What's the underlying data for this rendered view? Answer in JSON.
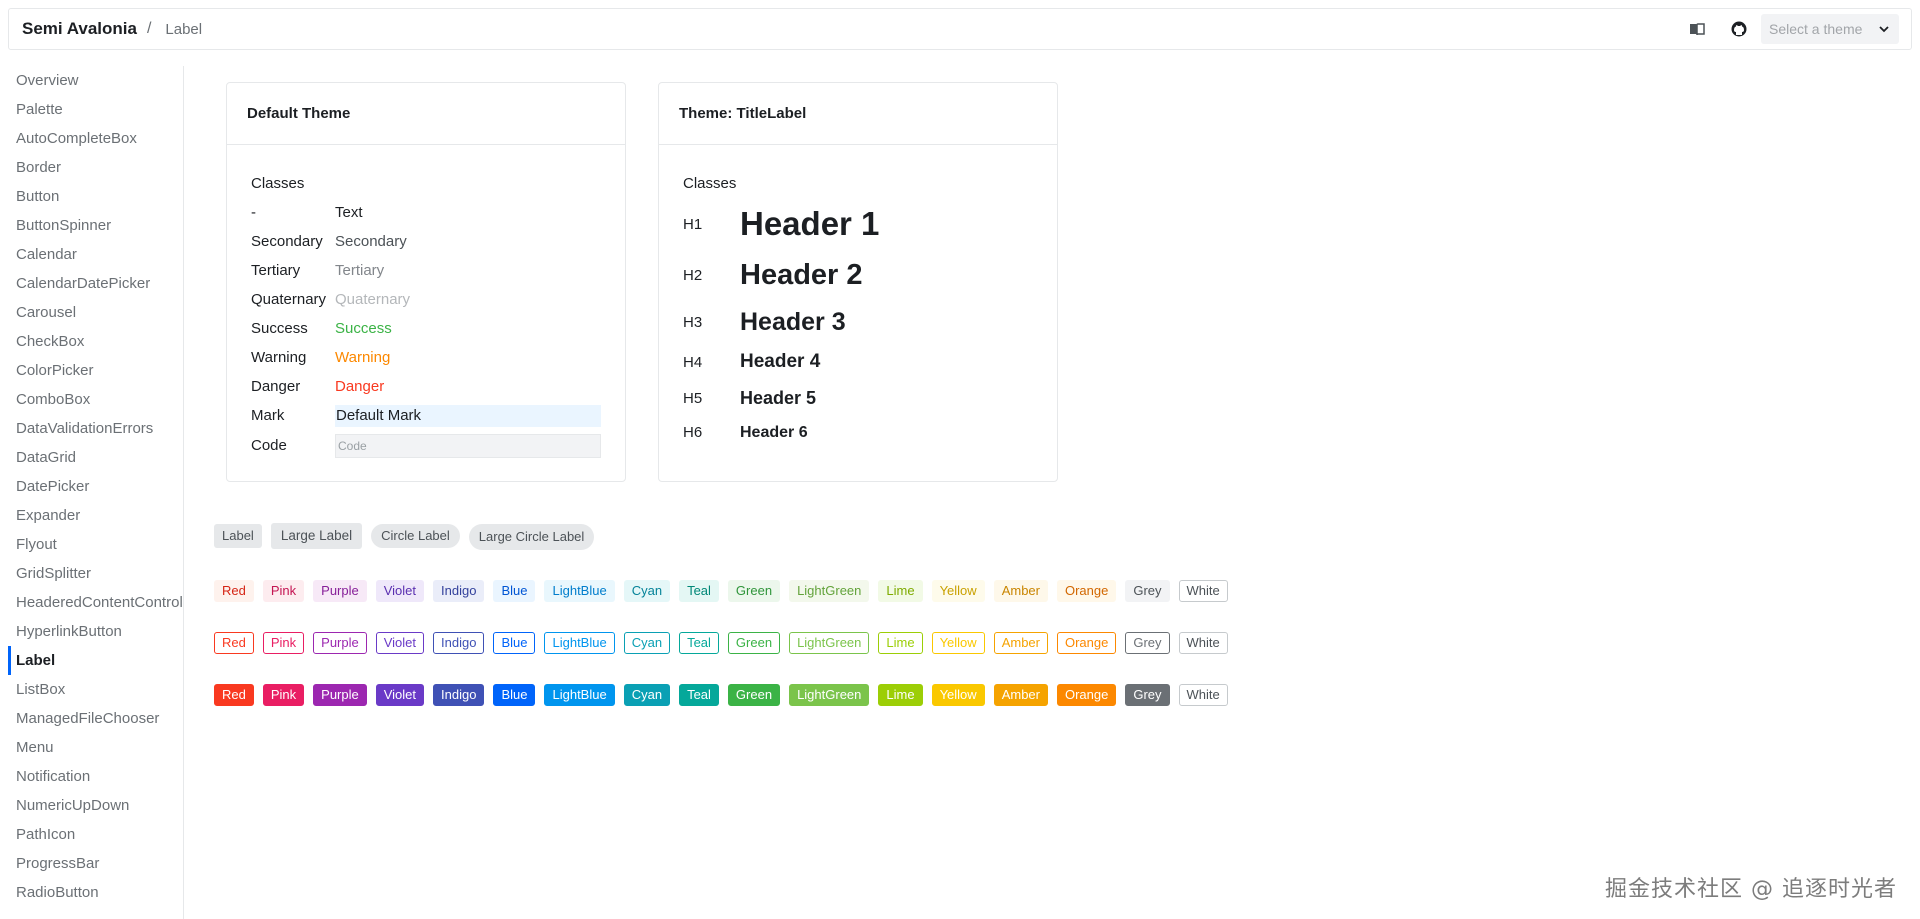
{
  "header": {
    "brand": "Semi Avalonia",
    "separator": "/",
    "crumb": "Label",
    "theme_placeholder": "Select a theme",
    "icons": [
      "book-icon",
      "github-icon",
      "chevron-down-icon"
    ]
  },
  "sidebar": {
    "items": [
      {
        "label": "Overview"
      },
      {
        "label": "Palette"
      },
      {
        "label": "AutoCompleteBox"
      },
      {
        "label": "Border"
      },
      {
        "label": "Button"
      },
      {
        "label": "ButtonSpinner"
      },
      {
        "label": "Calendar"
      },
      {
        "label": "CalendarDatePicker"
      },
      {
        "label": "Carousel"
      },
      {
        "label": "CheckBox"
      },
      {
        "label": "ColorPicker"
      },
      {
        "label": "ComboBox"
      },
      {
        "label": "DataValidationErrors"
      },
      {
        "label": "DataGrid"
      },
      {
        "label": "DatePicker"
      },
      {
        "label": "Expander"
      },
      {
        "label": "Flyout"
      },
      {
        "label": "GridSplitter"
      },
      {
        "label": "HeaderedContentControl"
      },
      {
        "label": "HyperlinkButton"
      },
      {
        "label": "Label",
        "active": true
      },
      {
        "label": "ListBox"
      },
      {
        "label": "ManagedFileChooser"
      },
      {
        "label": "Menu"
      },
      {
        "label": "Notification"
      },
      {
        "label": "NumericUpDown"
      },
      {
        "label": "PathIcon"
      },
      {
        "label": "ProgressBar"
      },
      {
        "label": "RadioButton"
      }
    ]
  },
  "default_card": {
    "title": "Default Theme",
    "classes_label": "Classes",
    "rows": [
      {
        "key": "-",
        "value": "Text"
      },
      {
        "key": "Secondary",
        "value": "Secondary"
      },
      {
        "key": "Tertiary",
        "value": "Tertiary"
      },
      {
        "key": "Quaternary",
        "value": "Quaternary"
      },
      {
        "key": "Success",
        "value": "Success"
      },
      {
        "key": "Warning",
        "value": "Warning"
      },
      {
        "key": "Danger",
        "value": "Danger"
      },
      {
        "key": "Mark",
        "value": "Default Mark"
      },
      {
        "key": "Code",
        "value": "Code"
      }
    ]
  },
  "title_card": {
    "title": "Theme: TitleLabel",
    "classes_label": "Classes",
    "rows": [
      {
        "key": "H1",
        "value": "Header 1"
      },
      {
        "key": "H2",
        "value": "Header 2"
      },
      {
        "key": "H3",
        "value": "Header 3"
      },
      {
        "key": "H4",
        "value": "Header 4"
      },
      {
        "key": "H5",
        "value": "Header 5"
      },
      {
        "key": "H6",
        "value": "Header 6"
      }
    ]
  },
  "basic_labels": [
    "Label",
    "Large Label",
    "Circle Label",
    "Large Circle Label"
  ],
  "color_labels": [
    {
      "name": "Red",
      "color": "#f93920",
      "light_bg": "#fef2ed",
      "light_fg": "#d52515"
    },
    {
      "name": "Pink",
      "color": "#e91e63",
      "light_bg": "#fdecef",
      "light_fg": "#c41552"
    },
    {
      "name": "Purple",
      "color": "#9c27b0",
      "light_bg": "#f7e9f7",
      "light_fg": "#871f99"
    },
    {
      "name": "Violet",
      "color": "#6a3ac7",
      "light_bg": "#efe8fa",
      "light_fg": "#5a2fb0"
    },
    {
      "name": "Indigo",
      "color": "#3f51b5",
      "light_bg": "#eaedf9",
      "light_fg": "#33419c"
    },
    {
      "name": "Blue",
      "color": "#0064fa",
      "light_bg": "#eaf5ff",
      "light_fg": "#0055d4"
    },
    {
      "name": "LightBlue",
      "color": "#0095ee",
      "light_bg": "#e9f7fd",
      "light_fg": "#007dcc"
    },
    {
      "name": "Cyan",
      "color": "#0aa0b4",
      "light_bg": "#e5f7f8",
      "light_fg": "#058399"
    },
    {
      "name": "Teal",
      "color": "#05a89a",
      "light_bg": "#e4f7f4",
      "light_fg": "#008777"
    },
    {
      "name": "Green",
      "color": "#3bb346",
      "light_bg": "#ecf7ec",
      "light_fg": "#30953b"
    },
    {
      "name": "LightGreen",
      "color": "#7bc44b",
      "light_bg": "#f3f8ec",
      "light_fg": "#63a33b"
    },
    {
      "name": "Lime",
      "color": "#9cce06",
      "light_bg": "#f2fae6",
      "light_fg": "#7eab00"
    },
    {
      "name": "Yellow",
      "color": "#fac800",
      "light_bg": "#fefbeb",
      "light_fg": "#c9a100"
    },
    {
      "name": "Amber",
      "color": "#f5a300",
      "light_bg": "#fef8ea",
      "light_fg": "#c98500"
    },
    {
      "name": "Orange",
      "color": "#fc8800",
      "light_bg": "#fff8ea",
      "light_fg": "#d26700"
    },
    {
      "name": "Grey",
      "color": "#6b7075",
      "light_bg": "#f2f3f5",
      "light_fg": "#4c5257"
    },
    {
      "name": "White",
      "color": "#ffffff",
      "light_bg": "#ffffff",
      "light_fg": "#4c5257"
    }
  ],
  "watermark": "掘金技术社区 @ 追逐时光者"
}
